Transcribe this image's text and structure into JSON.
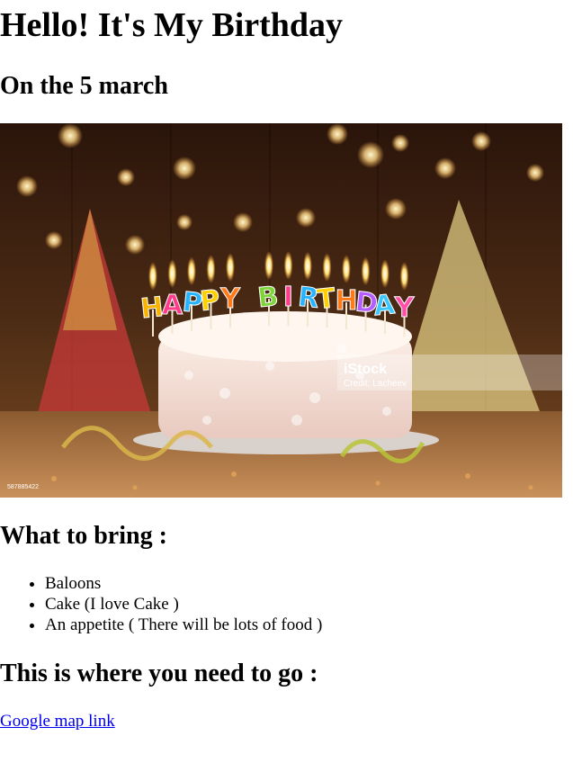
{
  "title": "Hello! It's My Birthday",
  "subtitle": "On the 5 march",
  "photo": {
    "candle_letters": [
      "H",
      "A",
      "P",
      "P",
      "Y",
      " ",
      "B",
      "I",
      "R",
      "T",
      "H",
      "D",
      "A",
      "Y"
    ],
    "letter_colors": [
      "#f6b400",
      "#ff3c8a",
      "#26b3ff",
      "#ffd000",
      "#ff7a1a",
      "#ffffff",
      "#7fd43a",
      "#ff3c8a",
      "#26b3ff",
      "#ffd000",
      "#ff7a1a",
      "#b55dff",
      "#3cc8ff",
      "#ff4fa8"
    ],
    "watermark_brand": "iStock",
    "watermark_credit": "Credit: Lacheev",
    "stock_id": "587885422"
  },
  "bring_heading": "What to bring :",
  "bring_items": [
    "Baloons",
    "Cake (I love Cake )",
    "An appetite ( There will be lots of food )"
  ],
  "go_heading": "This is where you need to go :",
  "map_link": "Google map link",
  "colors": {
    "link": "#0000ee"
  }
}
